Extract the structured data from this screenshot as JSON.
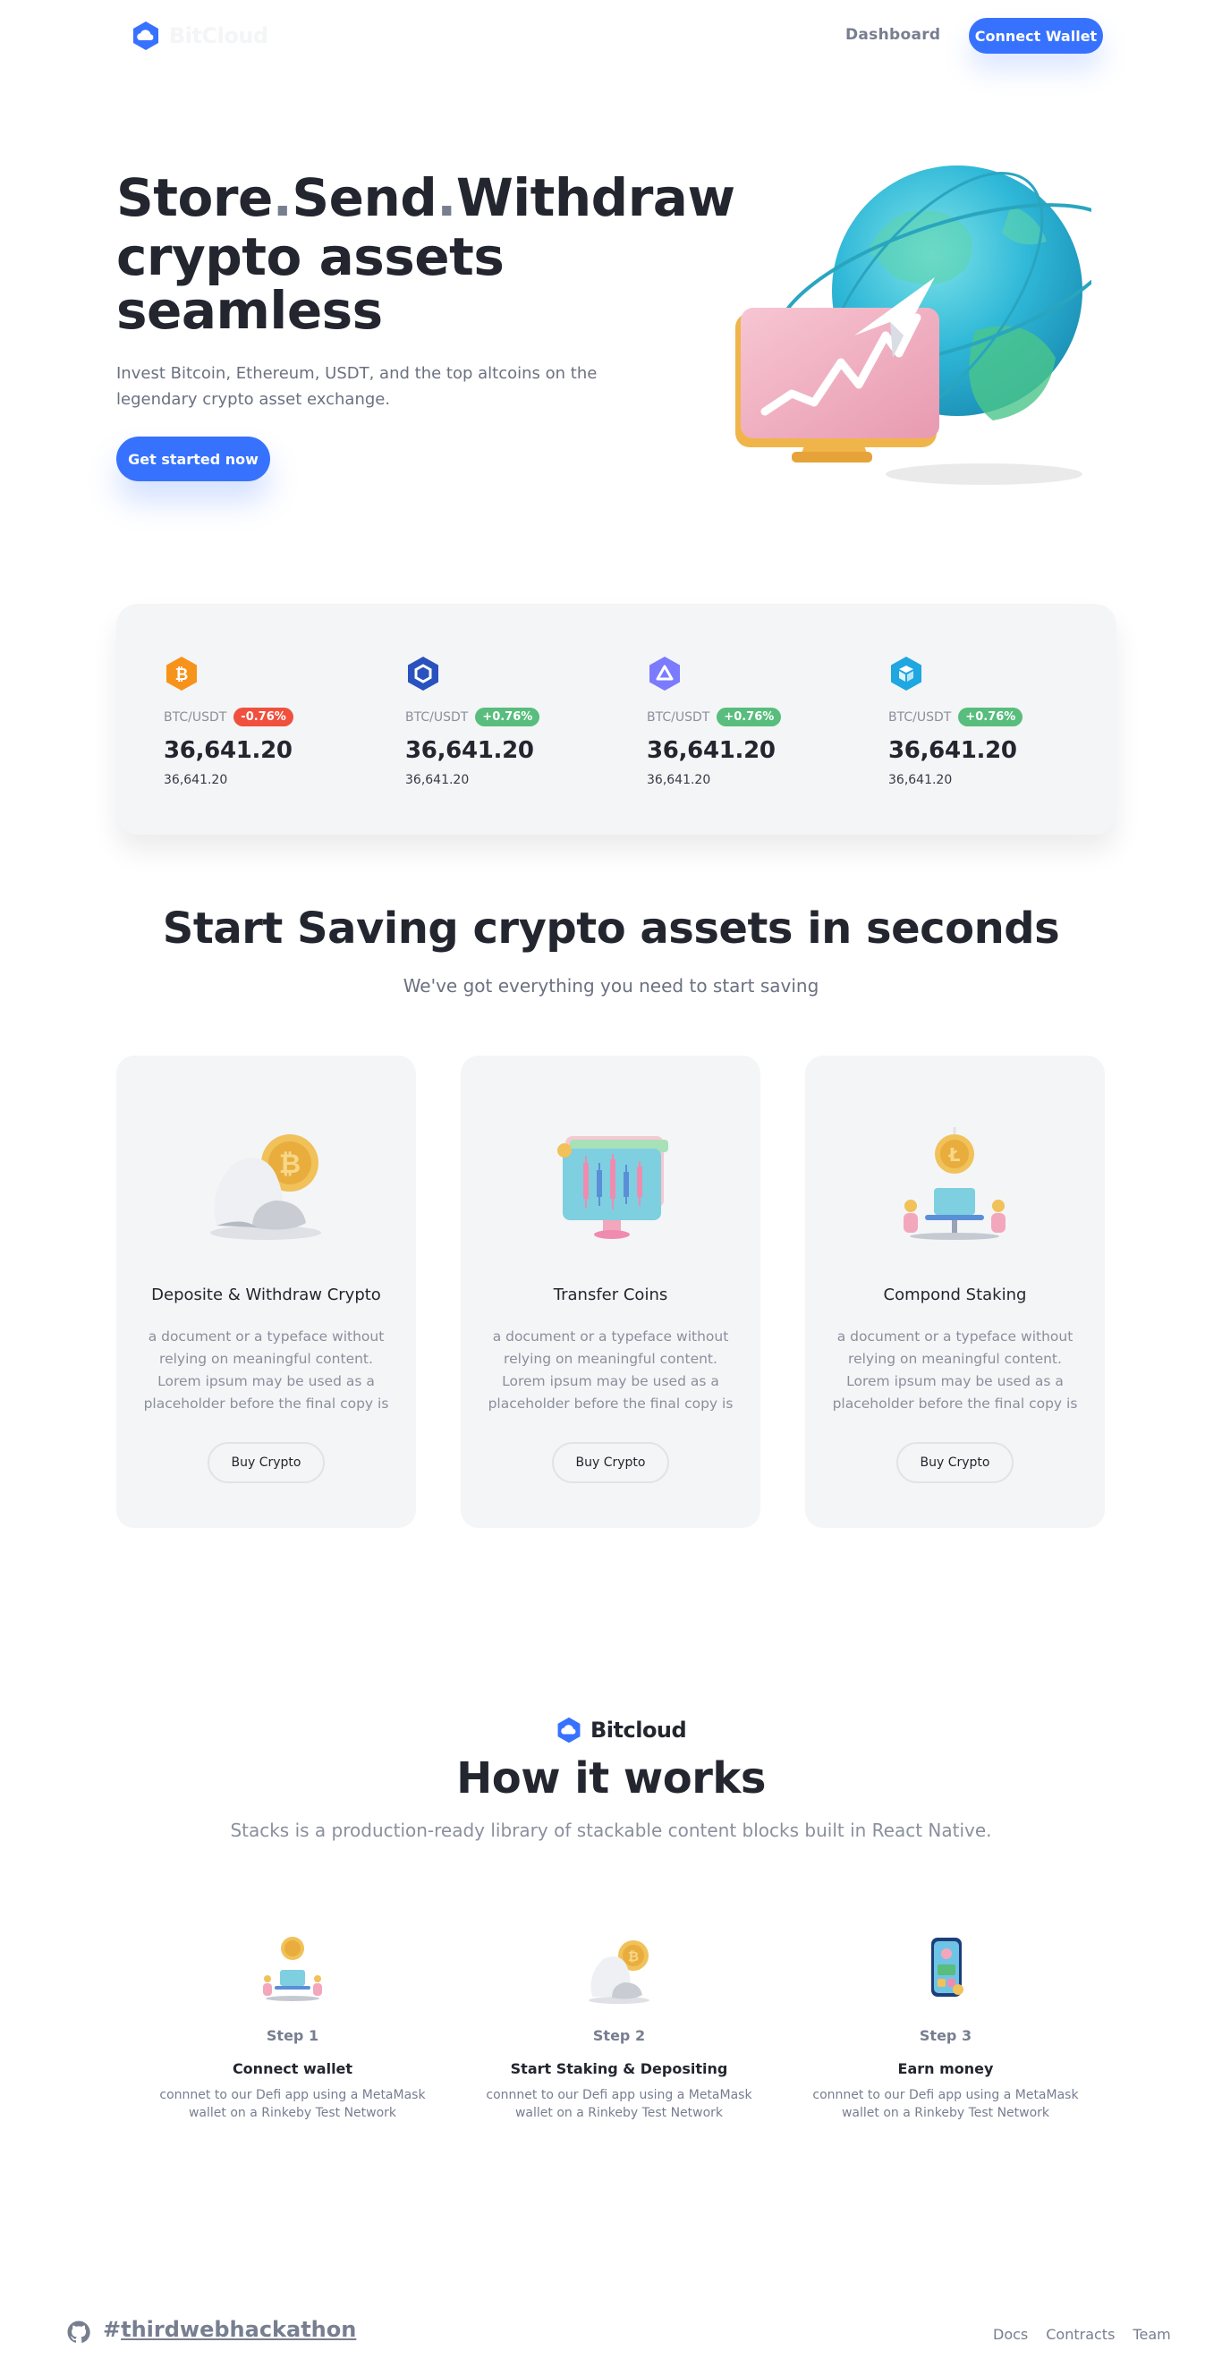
{
  "header": {
    "logo_text": "BitCloud",
    "nav_dashboard": "Dashboard",
    "connect_wallet": "Connect Wallet"
  },
  "hero": {
    "title_word1": "Store",
    "title_word2": "Send",
    "title_word3": "Withdraw",
    "title_line2": "crypto assets",
    "title_line3": "seamless",
    "description": "Invest Bitcoin, Ethereum, USDT, and the top altcoins on the legendary crypto asset exchange.",
    "cta": "Get started now"
  },
  "ticker": [
    {
      "icon": "bitcoin-icon",
      "color": "#f7931a",
      "pair": "BTC/USDT",
      "change": "-0.76%",
      "change_color": "#ef466f",
      "price": "36,641.20",
      "sub": "36,641.20"
    },
    {
      "icon": "hexagon-icon",
      "color": "#2a52be",
      "pair": "BTC/USDT",
      "change": "+0.76%",
      "change_color": "#58bd7d",
      "price": "36,641.20",
      "sub": "36,641.20"
    },
    {
      "icon": "triangle-icon",
      "color": "#7b7bff",
      "pair": "BTC/USDT",
      "change": "+0.76%",
      "change_color": "#58bd7d",
      "price": "36,641.20",
      "sub": "36,641.20"
    },
    {
      "icon": "cube-icon",
      "color": "#1ea7e1",
      "pair": "BTC/USDT",
      "change": "+0.76%",
      "change_color": "#58bd7d",
      "price": "36,641.20",
      "sub": "36,641.20"
    }
  ],
  "saving": {
    "title": "Start Saving crypto assets in seconds",
    "subtitle": "We've got everything you need to start saving",
    "cards": [
      {
        "title": "Deposite & Withdraw Crypto",
        "description": "a document or a typeface without relying on meaningful content. Lorem ipsum may be used as a placeholder before the final copy is",
        "button": "Buy Crypto"
      },
      {
        "title": "Transfer Coins",
        "description": "a document or a typeface without relying on meaningful content. Lorem ipsum may be used as a placeholder before the final copy is",
        "button": "Buy Crypto"
      },
      {
        "title": "Compond Staking",
        "description": "a document or a typeface without relying on meaningful content. Lorem ipsum may be used as a placeholder before the final copy is",
        "button": "Buy Crypto"
      }
    ]
  },
  "how": {
    "logo_text": "Bitcloud",
    "title": "How it works",
    "subtitle": "Stacks is a production-ready library of stackable content blocks built in React Native.",
    "steps": [
      {
        "step": "Step 1",
        "name": "Connect wallet",
        "description": "connnet to our Defi app using a MetaMask wallet on a Rinkeby Test Network"
      },
      {
        "step": "Step 2",
        "name": "Start Staking & Depositing",
        "description": "connnet to our Defi app using a MetaMask wallet on a Rinkeby Test Network"
      },
      {
        "step": "Step 3",
        "name": "Earn money",
        "description": "connnet to our Defi app using a MetaMask wallet on a Rinkeby Test Network"
      }
    ]
  },
  "footer": {
    "hash": "#",
    "hashtag": "thirdwebhackathon",
    "links": [
      "Docs",
      "Contracts",
      "Team"
    ]
  },
  "colors": {
    "accent": "#3772ff",
    "dark": "#23262f",
    "muted": "#777e90",
    "panel": "#f4f5f6"
  }
}
